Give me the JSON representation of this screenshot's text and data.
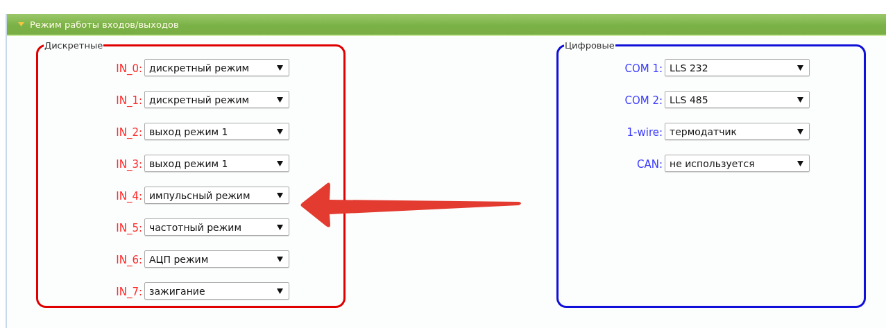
{
  "panel": {
    "title": "Режим работы входов/выходов",
    "expanded": true
  },
  "groups": [
    {
      "legend": "Дискретные",
      "color": "#e00000",
      "fields": [
        {
          "label": "IN_0:",
          "value": "дискретный режим"
        },
        {
          "label": "IN_1:",
          "value": "дискретный режим"
        },
        {
          "label": "IN_2:",
          "value": "выход режим 1"
        },
        {
          "label": "IN_3:",
          "value": "выход режим 1"
        },
        {
          "label": "IN_4:",
          "value": "импульсный режим"
        },
        {
          "label": "IN_5:",
          "value": "частотный режим"
        },
        {
          "label": "IN_6:",
          "value": "АЦП режим"
        },
        {
          "label": "IN_7:",
          "value": "зажигание"
        }
      ]
    },
    {
      "legend": "Цифровые",
      "color": "#1010d8",
      "fields": [
        {
          "label": "COM 1:",
          "value": "LLS 232"
        },
        {
          "label": "COM 2:",
          "value": "LLS 485"
        },
        {
          "label": "1-wire:",
          "value": "термодатчик"
        },
        {
          "label": "CAN:",
          "value": "не используется"
        }
      ]
    }
  ]
}
